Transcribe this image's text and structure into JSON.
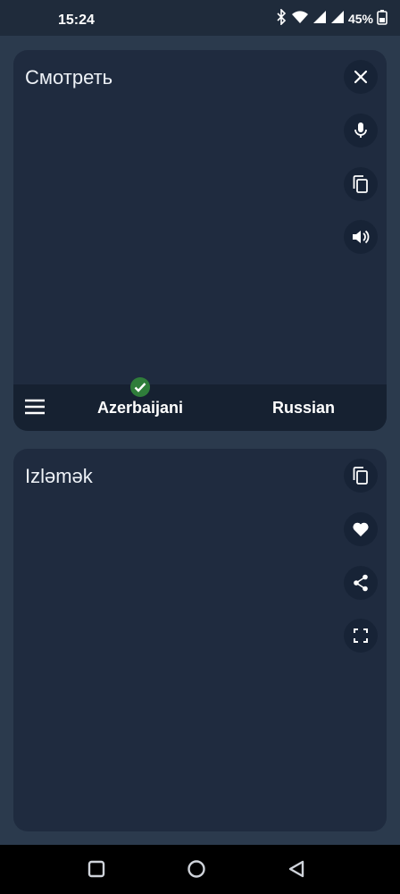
{
  "status_bar": {
    "time": "15:24",
    "battery": "45%",
    "icons": [
      "bluetooth-icon",
      "wifi-icon",
      "signal-icon",
      "signal-icon",
      "battery-icon"
    ]
  },
  "input_card": {
    "text": "Смотреть",
    "buttons": [
      "close-icon",
      "microphone-icon",
      "copy-icon",
      "speaker-icon"
    ]
  },
  "language_bar": {
    "source_language": "Azerbaijani",
    "target_language": "Russian",
    "source_selected": true
  },
  "output_card": {
    "text": "Izləmək",
    "buttons": [
      "copy-icon",
      "heart-icon",
      "share-icon",
      "fullscreen-icon"
    ]
  },
  "nav_bar": {
    "buttons": [
      "recents-icon",
      "home-icon",
      "back-icon"
    ]
  },
  "colors": {
    "background": "#2b3a4d",
    "card": "#1f2b3f",
    "button": "#172336",
    "check": "#2f7d3a"
  }
}
